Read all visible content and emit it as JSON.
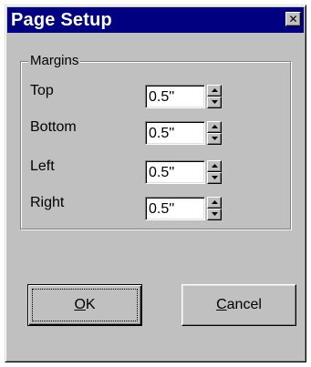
{
  "window": {
    "title": "Page Setup",
    "close_glyph": "✕",
    "title_bar_color": "#000080",
    "face_color": "#c0c0c0"
  },
  "margins": {
    "group_label": "Margins",
    "rows": [
      {
        "label": "Top",
        "value": "0.5''"
      },
      {
        "label": "Bottom",
        "value": "0.5''"
      },
      {
        "label": "Left",
        "value": "0.5''"
      },
      {
        "label": "Right",
        "value": "0.5''"
      }
    ]
  },
  "buttons": {
    "ok": {
      "mnemonic": "O",
      "rest": "K"
    },
    "cancel": {
      "mnemonic": "C",
      "rest": "ancel"
    }
  }
}
